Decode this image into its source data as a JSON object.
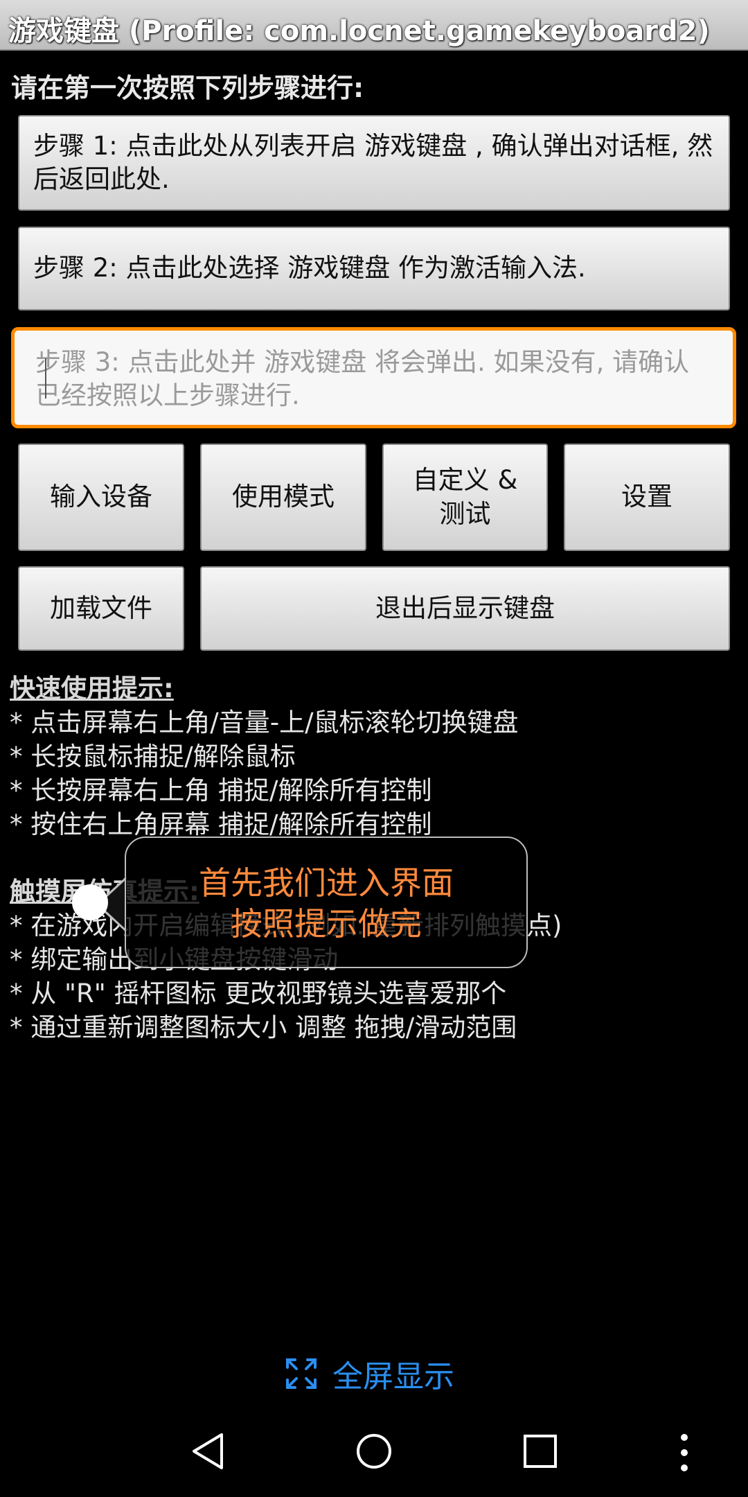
{
  "app": {
    "title": "游戏键盘 (Profile: com.locnet.gamekeyboard2)"
  },
  "instructions": {
    "heading": "请在第一次按照下列步骤进行:",
    "step1": "步骤 1: 点击此处从列表开启 游戏键盘 , 确认弹出对话框, 然后返回此处.",
    "step2": "步骤 2: 点击此处选择 游戏键盘 作为激活输入法.",
    "step3_placeholder": "步骤 3: 点击此处并 游戏键盘 将会弹出. 如果没有, 请确认已经按照以上步骤进行."
  },
  "buttons": {
    "input_device": "输入设备",
    "usage_mode": "使用模式",
    "customize_line1": "自定义 &",
    "customize_line2": "测试",
    "settings": "设置",
    "load_file": "加载文件",
    "show_keyboard_on_exit": "退出后显示键盘"
  },
  "quick_tips": {
    "heading": "快速使用提示:",
    "items": [
      "* 点击屏幕右上角/音量-上/鼠标滚轮切换键盘",
      "* 长按鼠标捕捉/解除鼠标",
      "* 长按屏幕右上角 捕捉/解除所有控制",
      "* 按住右上角屏幕 捕捉/解除所有控制"
    ]
  },
  "touch_tips": {
    "heading": "触摸屏仿真提示:",
    "items": [
      "* 在游戏内开启编辑模式 (例如. 重新排列触摸点)",
      "* 绑定输出到小键盘按键滑动",
      "* 从 \"R\" 摇杆图标 更改视野镜头选喜爱那个",
      "* 通过重新调整图标大小 调整 拖拽/滑动范围"
    ]
  },
  "tooltip": {
    "line1": "首先我们进入界面",
    "line2": "按照提示做完"
  },
  "fullscreen": {
    "label": "全屏显示",
    "icon": "expand-icon"
  },
  "colors": {
    "accent_orange": "#ff8a00",
    "link_blue": "#2a8ff0",
    "tooltip_text": "#ff8a3d"
  },
  "navbar": {
    "icons": [
      "back-icon",
      "home-icon",
      "recents-icon",
      "more-icon"
    ]
  }
}
